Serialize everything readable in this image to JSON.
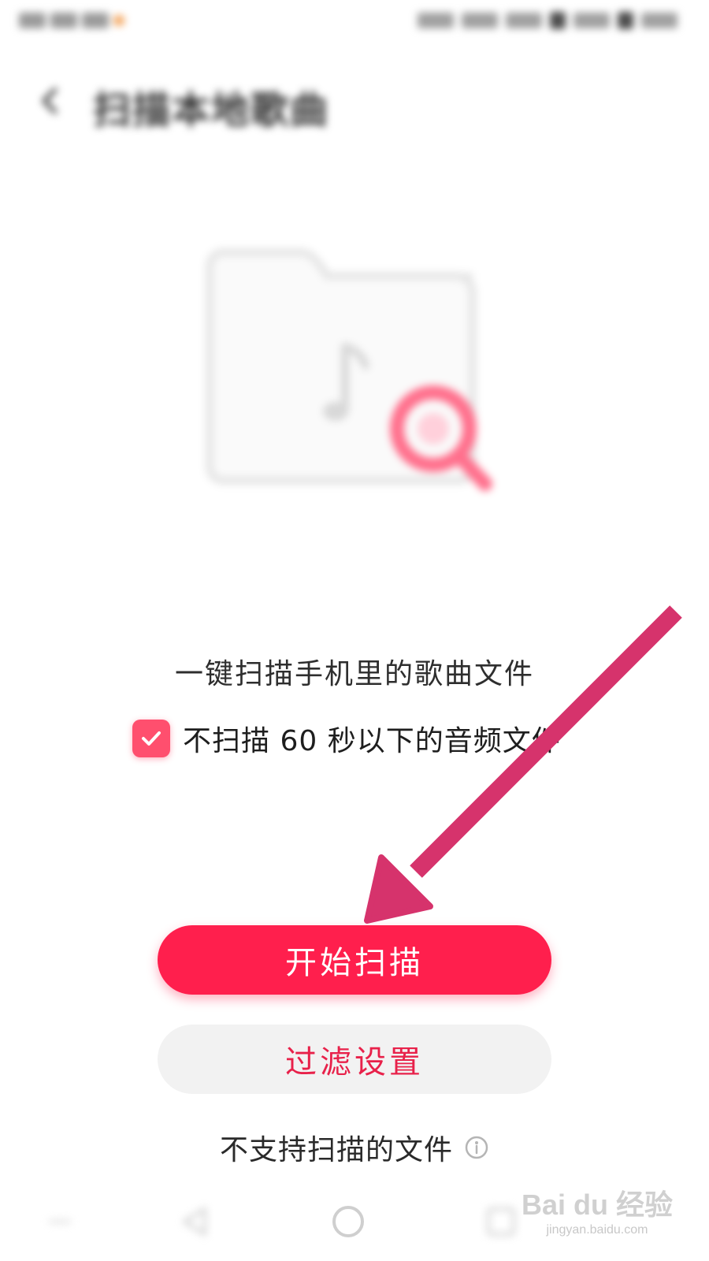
{
  "header": {
    "title": "扫描本地歌曲"
  },
  "main": {
    "scan_description": "一键扫描手机里的歌曲文件",
    "skip_short_checkbox": {
      "checked": true,
      "label": "不扫描 60 秒以下的音频文件"
    },
    "start_scan_label": "开始扫描",
    "filter_settings_label": "过滤设置",
    "unsupported_files_label": "不支持扫描的文件"
  },
  "watermark": {
    "logo_text": "Bai du 经验",
    "url": "jingyan.baidu.com"
  },
  "colors": {
    "accent": "#ff1f4d",
    "secondary_text": "#e8214a",
    "checkbox": "#ff4f6e",
    "annotation_arrow": "#d6336c"
  },
  "icons": {
    "back": "arrow-left-icon",
    "illustration": "music-folder-search-icon",
    "checkbox": "checkmark-icon",
    "info": "info-circle-icon",
    "nav": [
      "nav-back-triangle-icon",
      "nav-home-circle-icon",
      "nav-recents-square-icon"
    ]
  }
}
